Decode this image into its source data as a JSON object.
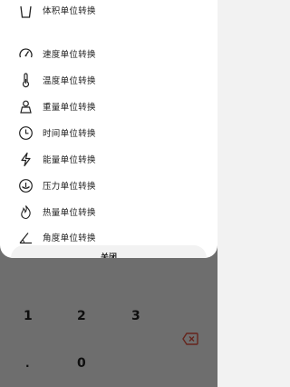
{
  "keypad": {
    "key_1": "1",
    "key_2": "2",
    "key_3": "3",
    "key_dot": ".",
    "key_0": "0",
    "backspace_icon": "backspace-icon",
    "backspace_color": "#e0503f"
  },
  "converter_menu": {
    "items": [
      {
        "label": "体积单位转换",
        "icon": "cup-icon"
      },
      {
        "label": "速度单位转换",
        "icon": "speedometer-icon"
      },
      {
        "label": "温度单位转换",
        "icon": "thermometer-icon"
      },
      {
        "label": "重量单位转换",
        "icon": "weight-icon"
      },
      {
        "label": "时间单位转换",
        "icon": "clock-icon"
      },
      {
        "label": "能量单位转换",
        "icon": "lightning-icon"
      },
      {
        "label": "压力单位转换",
        "icon": "pressure-icon"
      },
      {
        "label": "热量单位转换",
        "icon": "flame-icon"
      },
      {
        "label": "角度单位转换",
        "icon": "angle-icon"
      }
    ],
    "close_label": "关闭"
  }
}
